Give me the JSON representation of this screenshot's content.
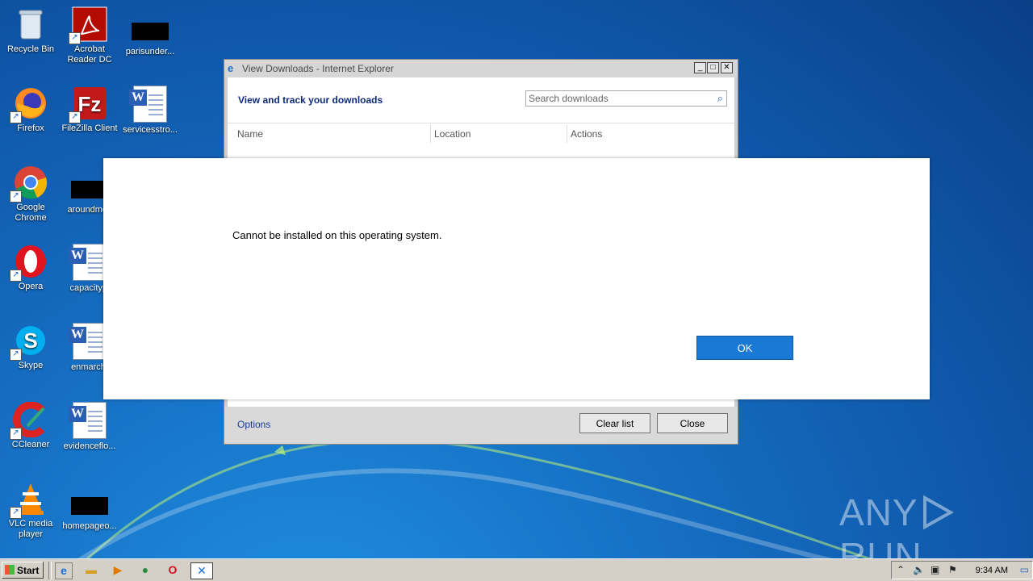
{
  "desktop": {
    "icons": [
      {
        "label": "Recycle Bin"
      },
      {
        "label": "Acrobat Reader DC"
      },
      {
        "label": "parisunder..."
      },
      {
        "label": "Firefox"
      },
      {
        "label": "FileZilla Client"
      },
      {
        "label": "servicesstro..."
      },
      {
        "label": "Google Chrome"
      },
      {
        "label": "aroundmov"
      },
      {
        "label": "Opera"
      },
      {
        "label": "capacitypl"
      },
      {
        "label": "Skype"
      },
      {
        "label": "enmarch."
      },
      {
        "label": "CCleaner"
      },
      {
        "label": "evidenceflo..."
      },
      {
        "label": "VLC media player"
      },
      {
        "label": "homepageo..."
      }
    ]
  },
  "downloads_window": {
    "title": "View Downloads - Internet Explorer",
    "heading": "View and track your downloads",
    "search_placeholder": "Search downloads",
    "columns": [
      "Name",
      "Location",
      "Actions"
    ],
    "options_link": "Options",
    "clear_list_label": "Clear list",
    "close_label": "Close"
  },
  "dialog": {
    "message": "Cannot be installed on this operating system.",
    "ok_label": "OK"
  },
  "watermark": {
    "left": "ANY",
    "right": "RUN"
  },
  "taskbar": {
    "start_label": "Start",
    "clock": "9:34 AM"
  }
}
